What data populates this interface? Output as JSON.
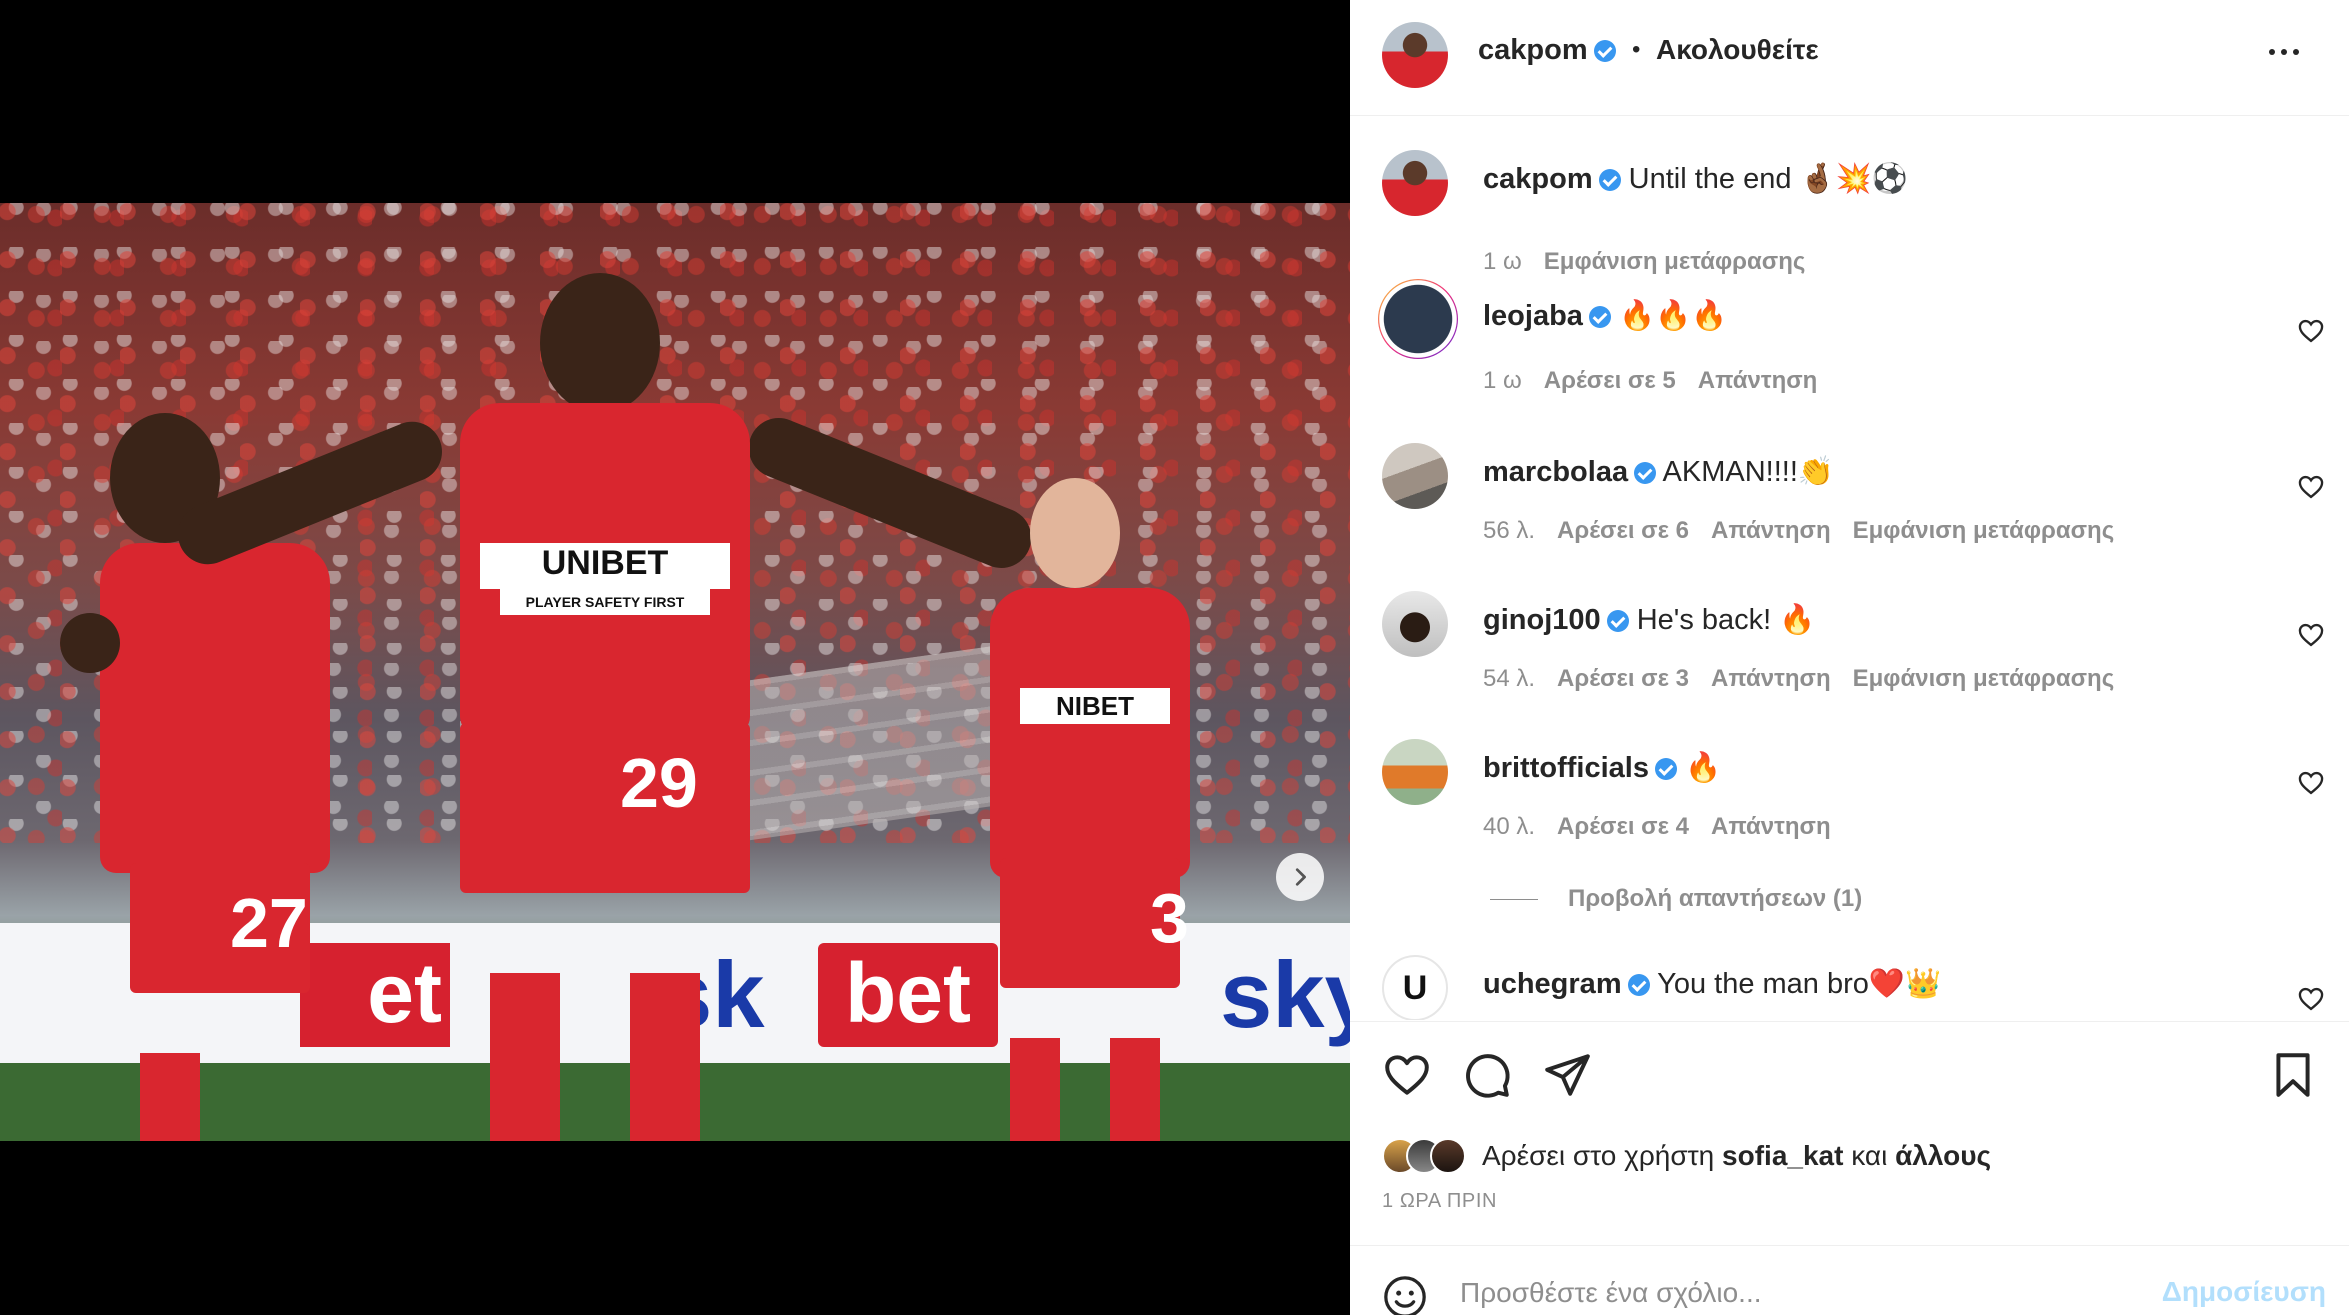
{
  "header": {
    "username": "cakpom",
    "separator": "•",
    "follow_label": "Ακολουθείτε"
  },
  "caption": {
    "username": "cakpom",
    "text": "Until the end 🤞🏾💥⚽",
    "time": "1 ω",
    "translate": "Εμφάνιση μετάφρασης"
  },
  "comments": [
    {
      "username": "leojaba",
      "text": "🔥🔥🔥",
      "time": "1 ω",
      "likes": "Αρέσει σε 5",
      "reply": "Απάντηση",
      "translate": ""
    },
    {
      "username": "marcbolaa",
      "text": "AKMAN!!!!👏",
      "time": "56 λ.",
      "likes": "Αρέσει σε 6",
      "reply": "Απάντηση",
      "translate": "Εμφάνιση μετάφρασης"
    },
    {
      "username": "ginoj100",
      "text": "He's back! 🔥",
      "time": "54 λ.",
      "likes": "Αρέσει σε 3",
      "reply": "Απάντηση",
      "translate": "Εμφάνιση μετάφρασης"
    },
    {
      "username": "brittofficials",
      "text": "🔥",
      "time": "40 λ.",
      "likes": "Αρέσει σε 4",
      "reply": "Απάντηση",
      "translate": ""
    },
    {
      "username": "uchegram",
      "text": "You the man bro❤️👑",
      "time": "",
      "likes": "",
      "reply": "",
      "translate": ""
    }
  ],
  "view_replies": "Προβολή απαντήσεων (1)",
  "likes_line": {
    "prefix": "Αρέσει στο χρήστη",
    "user": "sofia_kat",
    "middle": "και",
    "others": "άλλους"
  },
  "timestamp": "1 ΩΡΑ ΠΡΙΝ",
  "add_comment": {
    "placeholder": "Προσθέστε ένα σχόλιο...",
    "post_label": "Δημοσίευση"
  },
  "photo": {
    "sponsor": "UNIBET",
    "sponsor_sub": "PLAYER SAFETY FIRST",
    "numbers": [
      "27",
      "29",
      "3"
    ],
    "boards": [
      "et",
      "bet",
      "sky",
      "sk"
    ],
    "carousel": {
      "slides": 3,
      "active": 1
    }
  },
  "colors": {
    "verified": "#3897f0",
    "post_disabled": "#b2dffc",
    "kit_red": "#d9262f"
  }
}
